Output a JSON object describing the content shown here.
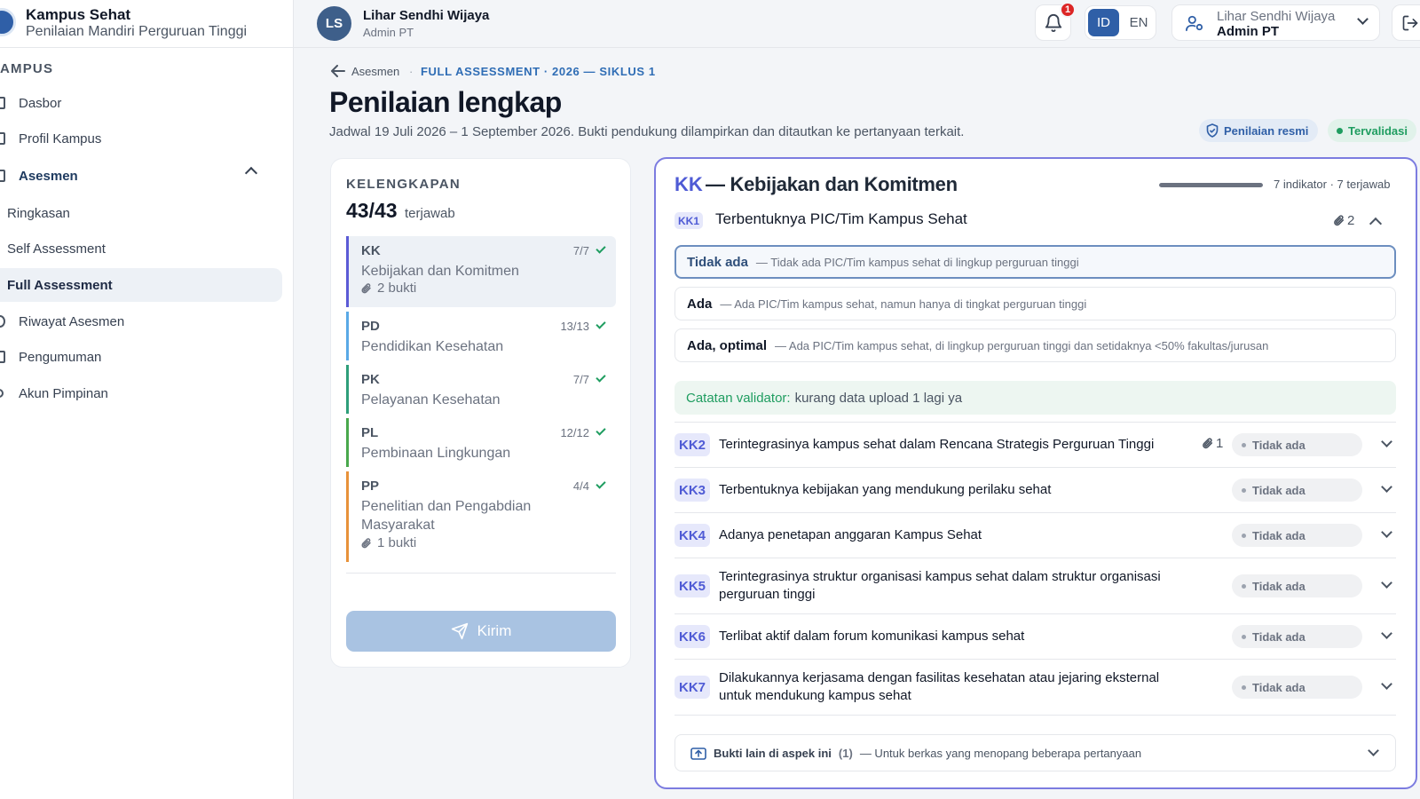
{
  "app": {
    "title": "Kampus Sehat",
    "subtitle": "Penilaian Mandiri Perguruan Tinggi"
  },
  "sidebar": {
    "section": "AMPUS",
    "items": [
      {
        "label": "Dasbor"
      },
      {
        "label": "Profil Kampus"
      },
      {
        "label": "Asesmen"
      },
      {
        "label": "Ringkasan"
      },
      {
        "label": "Self Assessment"
      },
      {
        "label": "Full Assessment"
      },
      {
        "label": "Riwayat Asesmen"
      },
      {
        "label": "Pengumuman"
      },
      {
        "label": "Akun Pimpinan"
      }
    ]
  },
  "topbar": {
    "user_initials": "LS",
    "user_name": "Lihar Sendhi Wijaya",
    "user_role": "Admin PT",
    "notif_count": "1",
    "lang_id": "ID",
    "lang_en": "EN",
    "menu_name": "Lihar Sendhi Wijaya",
    "menu_role": "Admin PT"
  },
  "header": {
    "breadcrumb_back": "Asesmen",
    "breadcrumb_sep": "·",
    "breadcrumb_current": "FULL ASSESSMENT · 2026 — SIKLUS 1",
    "title": "Penilaian lengkap",
    "description": "Jadwal 19 Juli 2026 – 1 September 2026. Bukti pendukung dilampirkan dan ditautkan ke pertanyaan terkait.",
    "badge_official": "Penilaian resmi",
    "badge_validated": "Tervalidasi"
  },
  "completeness": {
    "label": "KELENGKAPAN",
    "count": "43/43",
    "suffix": "terjawab",
    "aspects": [
      {
        "code": "KK",
        "name": "Kebijakan dan Komitmen",
        "count": "7/7",
        "evidence": "2 bukti",
        "color": "#5b5bd6"
      },
      {
        "code": "PD",
        "name": "Pendidikan Kesehatan",
        "count": "13/13",
        "evidence": "",
        "color": "#5aa9e6"
      },
      {
        "code": "PK",
        "name": "Pelayanan Kesehatan",
        "count": "7/7",
        "evidence": "",
        "color": "#2e9e7a"
      },
      {
        "code": "PL",
        "name": "Pembinaan Lingkungan",
        "count": "12/12",
        "evidence": "",
        "color": "#49a84c"
      },
      {
        "code": "PP",
        "name": "Penelitian dan Pengabdian Masyarakat",
        "count": "4/4",
        "evidence": "1 bukti",
        "color": "#e8923a"
      }
    ],
    "submit_label": "Kirim"
  },
  "detail": {
    "code": "KK",
    "title": "— Kebijakan dan Komitmen",
    "progress": 1.0,
    "progress_text": "7 indikator · 7 terjawab",
    "expanded": {
      "code": "KK1",
      "title": "Terbentuknya PIC/Tim Kampus Sehat",
      "evidence_count": "2",
      "options": [
        {
          "label": "Tidak ada",
          "desc": "— Tidak ada PIC/Tim kampus sehat di lingkup perguruan tinggi",
          "selected": true
        },
        {
          "label": "Ada",
          "desc": "— Ada PIC/Tim kampus sehat, namun hanya di tingkat perguruan tinggi",
          "selected": false
        },
        {
          "label": "Ada, optimal",
          "desc": "— Ada PIC/Tim kampus sehat, di lingkup perguruan tinggi dan setidaknya <50% fakultas/jurusan",
          "selected": false
        }
      ],
      "note_label": "Catatan validator:",
      "note_text": "kurang data upload 1 lagi ya"
    },
    "indicators": [
      {
        "code": "KK2",
        "title": "Terintegrasinya kampus sehat dalam Rencana Strategis Perguruan Tinggi",
        "evidence": "1",
        "status": "Tidak ada"
      },
      {
        "code": "KK3",
        "title": "Terbentuknya kebijakan yang mendukung perilaku sehat",
        "evidence": "",
        "status": "Tidak ada"
      },
      {
        "code": "KK4",
        "title": "Adanya penetapan anggaran Kampus Sehat",
        "evidence": "",
        "status": "Tidak ada"
      },
      {
        "code": "KK5",
        "title": "Terintegrasinya struktur organisasi kampus sehat dalam struktur organisasi perguruan tinggi",
        "evidence": "",
        "status": "Tidak ada"
      },
      {
        "code": "KK6",
        "title": "Terlibat aktif dalam forum komunikasi kampus sehat",
        "evidence": "",
        "status": "Tidak ada"
      },
      {
        "code": "KK7",
        "title": "Dilakukannya kerjasama dengan fasilitas kesehatan atau jejaring eksternal untuk mendukung kampus sehat",
        "evidence": "",
        "status": "Tidak ada"
      }
    ],
    "other_evidence": {
      "label": "Bukti lain di aspek ini",
      "count": "(1)",
      "desc": "— Untuk berkas yang menopang beberapa pertanyaan"
    }
  }
}
